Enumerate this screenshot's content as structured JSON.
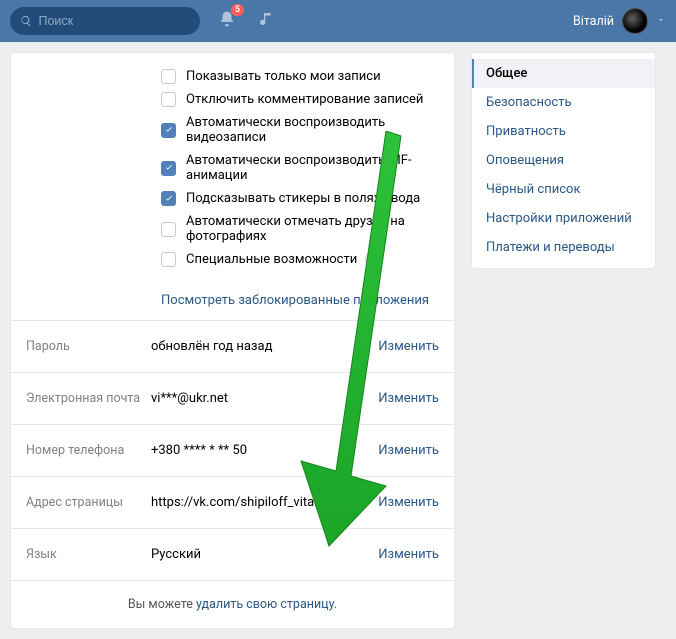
{
  "topbar": {
    "search_placeholder": "Поиск",
    "notif_badge": "5",
    "user_name": "Віталій"
  },
  "checkboxes": [
    {
      "label": "Показывать только мои записи",
      "checked": false
    },
    {
      "label": "Отключить комментирование записей",
      "checked": false
    },
    {
      "label": "Автоматически воспроизводить видеозаписи",
      "checked": true
    },
    {
      "label": "Автоматически воспроизводить GIF-анимации",
      "checked": true
    },
    {
      "label": "Подсказывать стикеры в полях ввода",
      "checked": true
    },
    {
      "label": "Автоматически отмечать друзей на фотографиях",
      "checked": false
    },
    {
      "label": "Специальные возможности",
      "checked": false,
      "help": true
    }
  ],
  "blocked_apps_link": "Посмотреть заблокированные приложения",
  "settings": {
    "password": {
      "label": "Пароль",
      "value": "обновлён год назад",
      "action": "Изменить"
    },
    "email": {
      "label": "Электронная почта",
      "value": "vi***@ukr.net",
      "action": "Изменить"
    },
    "phone": {
      "label": "Номер телефона",
      "value": "+380 **** * ** 50",
      "action": "Изменить"
    },
    "address": {
      "label": "Адрес страницы",
      "value": "https://vk.com/shipiloff_vitalik",
      "action": "Изменить"
    },
    "language": {
      "label": "Язык",
      "value": "Русский",
      "action": "Изменить"
    }
  },
  "footer": {
    "prefix": "Вы можете ",
    "link": "удалить свою страницу",
    "suffix": "."
  },
  "sidebar": {
    "items": [
      "Общее",
      "Безопасность",
      "Приватность",
      "Оповещения",
      "Чёрный список",
      "Настройки приложений",
      "Платежи и переводы"
    ],
    "active_index": 0
  },
  "arrow_color": "#2dc23a"
}
